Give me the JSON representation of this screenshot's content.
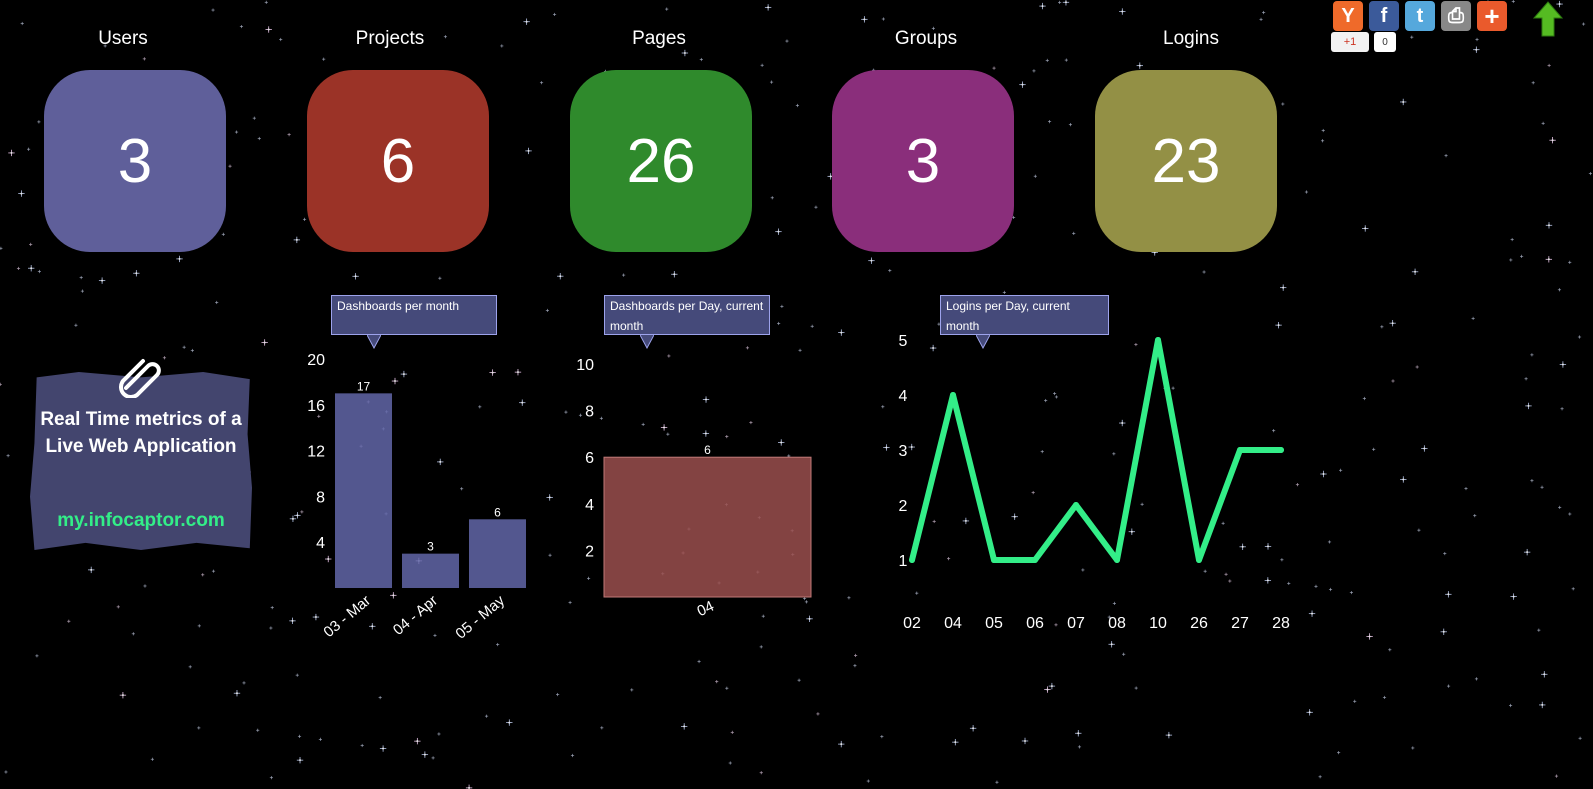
{
  "kpis": [
    {
      "label": "Users",
      "value": "3",
      "color": "#5f5f9a"
    },
    {
      "label": "Projects",
      "value": "6",
      "color": "#9b3327"
    },
    {
      "label": "Pages",
      "value": "26",
      "color": "#2f8a2c"
    },
    {
      "label": "Groups",
      "value": "3",
      "color": "#8a2e7b"
    },
    {
      "label": "Logins",
      "value": "23",
      "color": "#939045"
    }
  ],
  "note": {
    "title": "Real Time metrics of a Live Web Application",
    "link": "my.infocaptor.com",
    "icon": "paperclip-icon"
  },
  "share": {
    "buttons": [
      {
        "name": "yahoo",
        "glyph": "Y",
        "color": "#ef6a2a"
      },
      {
        "name": "facebook",
        "glyph": "f",
        "color": "#3b5a9a"
      },
      {
        "name": "twitter",
        "glyph": "t",
        "color": "#55a8dc"
      },
      {
        "name": "print",
        "glyph": "⎙",
        "color": "#888888"
      },
      {
        "name": "more",
        "glyph": "+",
        "color": "#ea5a2c"
      }
    ],
    "gplus_label": "+1",
    "gplus_count": "0",
    "top_icon": "up-arrow-icon"
  },
  "chart_data": [
    {
      "type": "bar",
      "title": "Dashboards per month",
      "categories": [
        "03 - Mar",
        "04 - Apr",
        "05 - May"
      ],
      "values": [
        17,
        3,
        6
      ],
      "yticks": [
        4,
        8,
        12,
        16,
        20
      ],
      "ylim": [
        0,
        20
      ],
      "color": "#6266a8",
      "grid": false
    },
    {
      "type": "bar",
      "title": "Dashboards per Day, current month",
      "categories": [
        "04"
      ],
      "values": [
        6
      ],
      "yticks": [
        2,
        4,
        6,
        8,
        10
      ],
      "ylim": [
        0,
        10
      ],
      "color": "#9a4f4d",
      "grid": false
    },
    {
      "type": "line",
      "title": "Logins per Day, current month",
      "categories": [
        "02",
        "04",
        "05",
        "06",
        "07",
        "08",
        "10",
        "26",
        "27",
        "28"
      ],
      "values": [
        1,
        4,
        1,
        1,
        2,
        1,
        5,
        1,
        3,
        3
      ],
      "yticks": [
        1,
        2,
        3,
        4,
        5
      ],
      "ylim": [
        1,
        5
      ],
      "color": "#33ee88",
      "grid": false
    }
  ]
}
